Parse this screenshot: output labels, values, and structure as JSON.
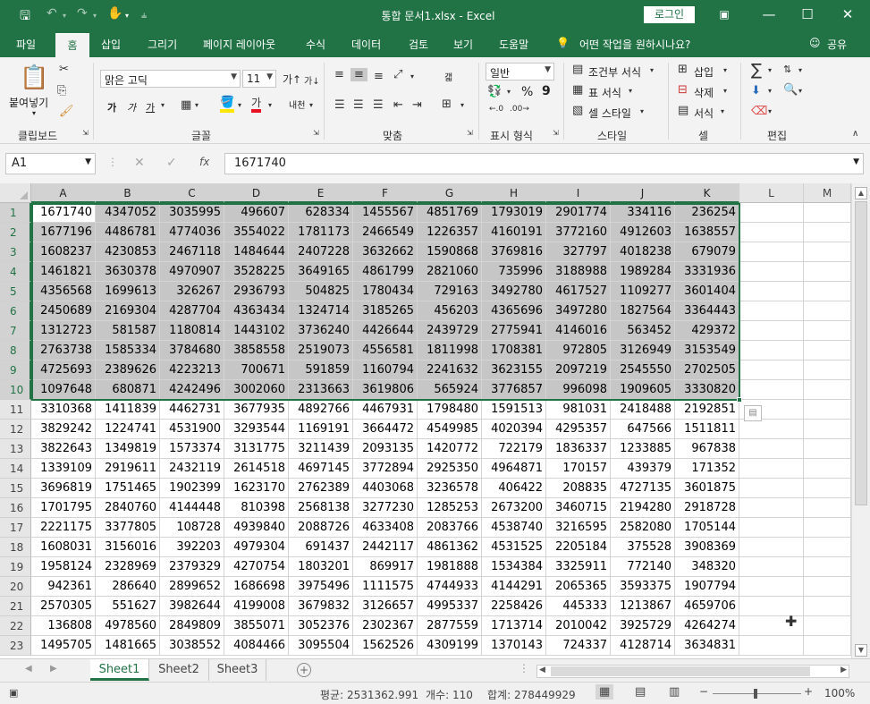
{
  "app": {
    "title": "통합 문서1.xlsx  -  Excel",
    "login_label": "로그인"
  },
  "titlebar_icons": [
    "save-icon",
    "undo-icon",
    "redo-icon",
    "touch-mode-icon",
    "customize-icon"
  ],
  "ribbon_tabs": [
    "파일",
    "홈",
    "삽입",
    "그리기",
    "페이지 레이아웃",
    "수식",
    "데이터",
    "검토",
    "보기",
    "도움말"
  ],
  "tell_me": "어떤 작업을 원하시나요?",
  "share_label": "공유",
  "ribbon": {
    "paste_label": "붙여넣기",
    "font_name": "맑은 고딕",
    "font_size": "11",
    "number_format": "일반",
    "bold": "가",
    "italic": "가",
    "underline": "가",
    "wrap": "내천",
    "wrap_icon": "갧",
    "percent": "%",
    "comma": "9",
    "conditional_format": "조건부 서식",
    "format_table": "표 서식",
    "cell_style": "셀 스타일",
    "insert": "삽입",
    "delete": "삭제",
    "format": "서식",
    "groups": [
      "클립보드",
      "글꼴",
      "맞춤",
      "표시 형식",
      "스타일",
      "셀",
      "편집"
    ]
  },
  "formula_bar": {
    "name_box": "A1",
    "value": "1671740"
  },
  "columns": [
    "A",
    "B",
    "C",
    "D",
    "E",
    "F",
    "G",
    "H",
    "I",
    "J",
    "K",
    "L",
    "M"
  ],
  "selected_range": "A1:K10",
  "rows": [
    [
      1671740,
      4347052,
      3035995,
      496607,
      628334,
      1455567,
      4851769,
      1793019,
      2901774,
      334116,
      236254
    ],
    [
      1677196,
      4486781,
      4774036,
      3554022,
      1781173,
      2466549,
      1226357,
      4160191,
      3772160,
      4912603,
      1638557
    ],
    [
      1608237,
      4230853,
      2467118,
      1484644,
      2407228,
      3632662,
      1590868,
      3769816,
      327797,
      4018238,
      679079
    ],
    [
      1461821,
      3630378,
      4970907,
      3528225,
      3649165,
      4861799,
      2821060,
      735996,
      3188988,
      1989284,
      3331936
    ],
    [
      4356568,
      1699613,
      326267,
      2936793,
      504825,
      1780434,
      729163,
      3492780,
      4617527,
      1109277,
      3601404
    ],
    [
      2450689,
      2169304,
      4287704,
      4363434,
      1324714,
      3185265,
      456203,
      4365696,
      3497280,
      1827564,
      3364443
    ],
    [
      1312723,
      581587,
      1180814,
      1443102,
      3736240,
      4426644,
      2439729,
      2775941,
      4146016,
      563452,
      429372
    ],
    [
      2763738,
      1585334,
      3784680,
      3858558,
      2519073,
      4556581,
      1811998,
      1708381,
      972805,
      3126949,
      3153549
    ],
    [
      4725693,
      2389626,
      4223213,
      700671,
      591859,
      1160794,
      2241632,
      3623155,
      2097219,
      2545550,
      2702505
    ],
    [
      1097648,
      680871,
      4242496,
      3002060,
      2313663,
      3619806,
      565924,
      3776857,
      996098,
      1909605,
      3330820
    ],
    [
      3310368,
      1411839,
      4462731,
      3677935,
      4892766,
      4467931,
      1798480,
      1591513,
      981031,
      2418488,
      2192851
    ],
    [
      3829242,
      1224741,
      4531900,
      3293544,
      1169191,
      3664472,
      4549985,
      4020394,
      4295357,
      647566,
      1511811
    ],
    [
      3822643,
      1349819,
      1573374,
      3131775,
      3211439,
      2093135,
      1420772,
      722179,
      1836337,
      1233885,
      967838
    ],
    [
      1339109,
      2919611,
      2432119,
      2614518,
      4697145,
      3772894,
      2925350,
      4964871,
      170157,
      439379,
      171352
    ],
    [
      3696819,
      1751465,
      1902399,
      1623170,
      2762389,
      4403068,
      3236578,
      406422,
      208835,
      4727135,
      3601875
    ],
    [
      1701795,
      2840760,
      4144448,
      810398,
      2568138,
      3277230,
      1285253,
      2673200,
      3460715,
      2194280,
      2918728
    ],
    [
      2221175,
      3377805,
      108728,
      4939840,
      2088726,
      4633408,
      2083766,
      4538740,
      3216595,
      2582080,
      1705144
    ],
    [
      1608031,
      3156016,
      392203,
      4979304,
      691437,
      2442117,
      4861362,
      4531525,
      2205184,
      375528,
      3908369
    ],
    [
      1958124,
      2328969,
      2379329,
      4270754,
      1803201,
      869917,
      1981888,
      1534384,
      3325911,
      772140,
      348320
    ],
    [
      942361,
      286640,
      2899652,
      1686698,
      3975496,
      1111575,
      4744933,
      4144291,
      2065365,
      3593375,
      1907794
    ],
    [
      2570305,
      551627,
      3982644,
      4199008,
      3679832,
      3126657,
      4995337,
      2258426,
      445333,
      1213867,
      4659706
    ],
    [
      136808,
      4978560,
      2849809,
      3855071,
      3052376,
      2302367,
      2877559,
      1713714,
      2010042,
      3925729,
      4264274
    ],
    [
      1495705,
      1481665,
      3038552,
      4084466,
      3095504,
      1562526,
      4309199,
      1370143,
      724337,
      4128714,
      3634831
    ]
  ],
  "sheets": [
    "Sheet1",
    "Sheet2",
    "Sheet3"
  ],
  "active_sheet": "Sheet1",
  "status": {
    "average": "평균: 2531362.991",
    "count": "개수: 110",
    "sum": "합계: 278449929",
    "zoom": "100%"
  }
}
